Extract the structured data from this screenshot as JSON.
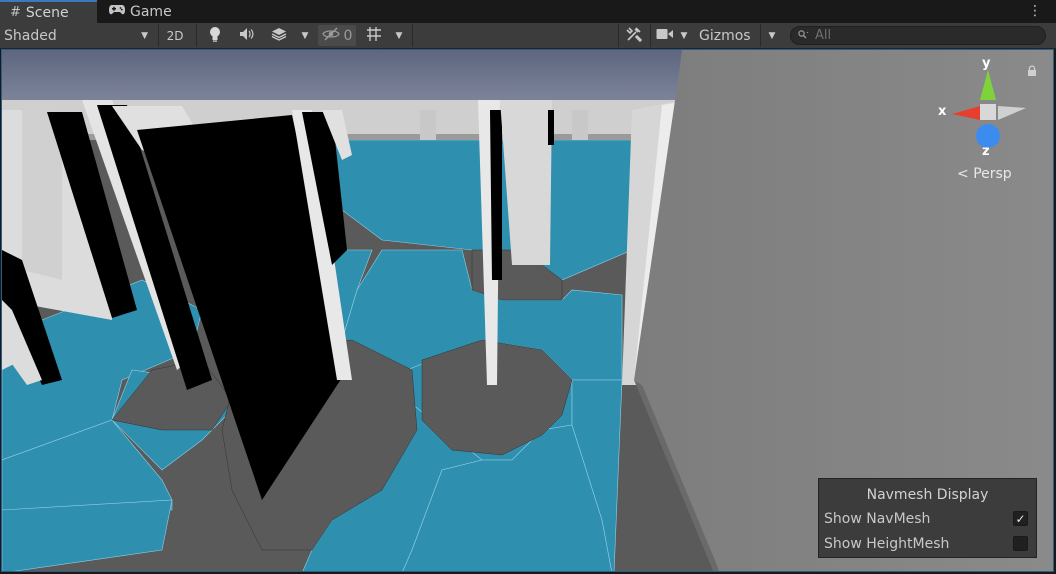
{
  "tabs": {
    "scene": {
      "icon": "#",
      "label": "Scene"
    },
    "game": {
      "icon": "gamepad-icon",
      "label": "Game"
    }
  },
  "toolbar": {
    "shading_mode": "Shaded",
    "mode_2d": "2D",
    "hidden_count": "0",
    "gizmos_label": "Gizmos",
    "search_placeholder": "All"
  },
  "scene_gizmo": {
    "axis_y": "y",
    "axis_x": "x",
    "axis_z": "z",
    "projection": "Persp",
    "colors": {
      "x": "#e5402f",
      "y": "#7fd33a",
      "z": "#3c8cf0"
    }
  },
  "navmesh_overlay": {
    "title": "Navmesh Display",
    "items": [
      {
        "label": "Show NavMesh",
        "checked": true
      },
      {
        "label": "Show HeightMesh",
        "checked": false
      }
    ]
  },
  "colors": {
    "accent": "#3a79bb",
    "navmesh": "#2f8fae",
    "floor": "#5c5c5c",
    "sky": "#7a8198"
  }
}
